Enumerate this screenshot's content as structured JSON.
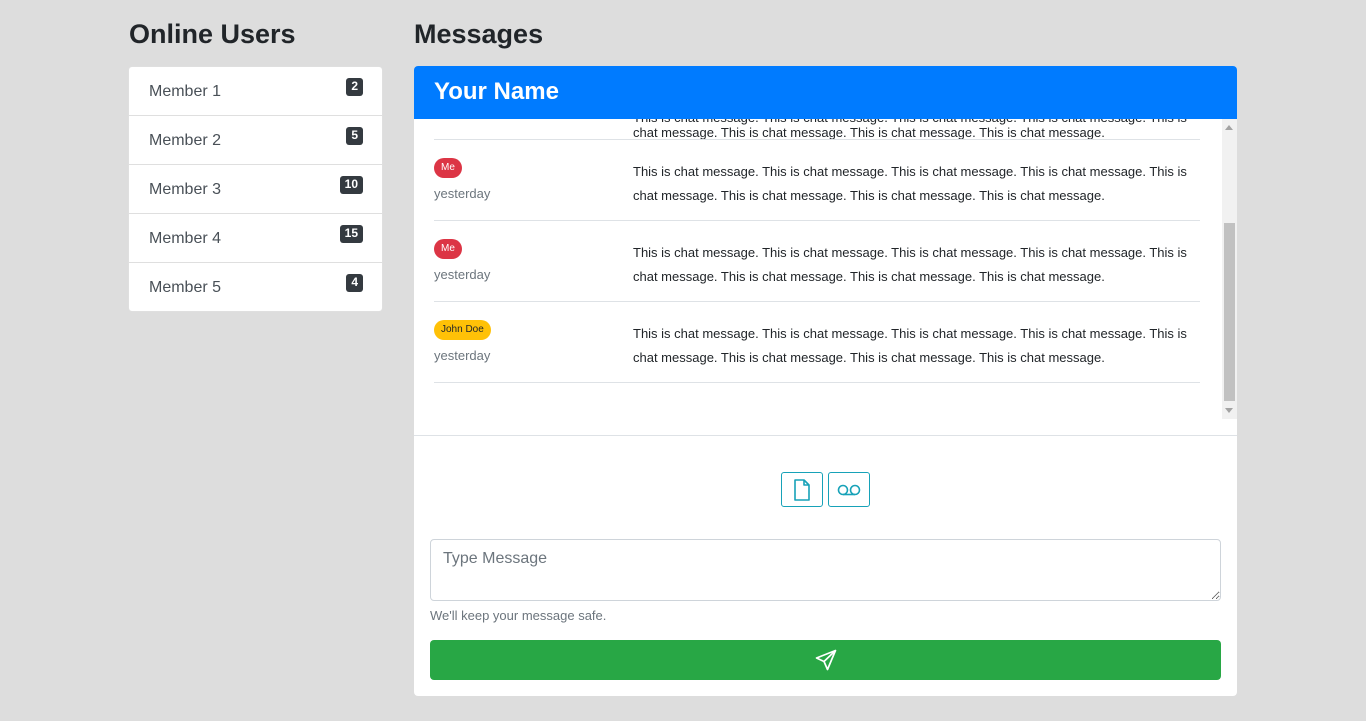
{
  "online_users": {
    "title": "Online Users",
    "members": [
      {
        "name": "Member 1",
        "count": "2"
      },
      {
        "name": "Member 2",
        "count": "5"
      },
      {
        "name": "Member 3",
        "count": "10"
      },
      {
        "name": "Member 4",
        "count": "15"
      },
      {
        "name": "Member 5",
        "count": "4"
      }
    ]
  },
  "messages": {
    "title": "Messages",
    "chat_header": "Your Name",
    "items": [
      {
        "sender": "Me",
        "sender_type": "me",
        "time": "yesterday",
        "text": "This is chat message. This is chat message. This is chat message. This is chat message. This is chat message. This is chat message. This is chat message. This is chat message."
      },
      {
        "sender": "Me",
        "sender_type": "me",
        "time": "yesterday",
        "text": "This is chat message. This is chat message. This is chat message. This is chat message. This is chat message. This is chat message. This is chat message. This is chat message."
      },
      {
        "sender": "John Doe",
        "sender_type": "other",
        "time": "yesterday",
        "text": "This is chat message. This is chat message. This is chat message. This is chat message. This is chat message. This is chat message. This is chat message. This is chat message."
      }
    ]
  },
  "composer": {
    "attach_icon": "file-icon",
    "voice_icon": "voicemail-icon",
    "placeholder": "Type Message",
    "help_text": "We'll keep your message safe.",
    "send_icon": "send-icon"
  },
  "colors": {
    "header": "#007bff",
    "send": "#28a745",
    "badge_me": "#dc3545",
    "badge_other": "#ffc107",
    "outline": "#17a2b8"
  }
}
